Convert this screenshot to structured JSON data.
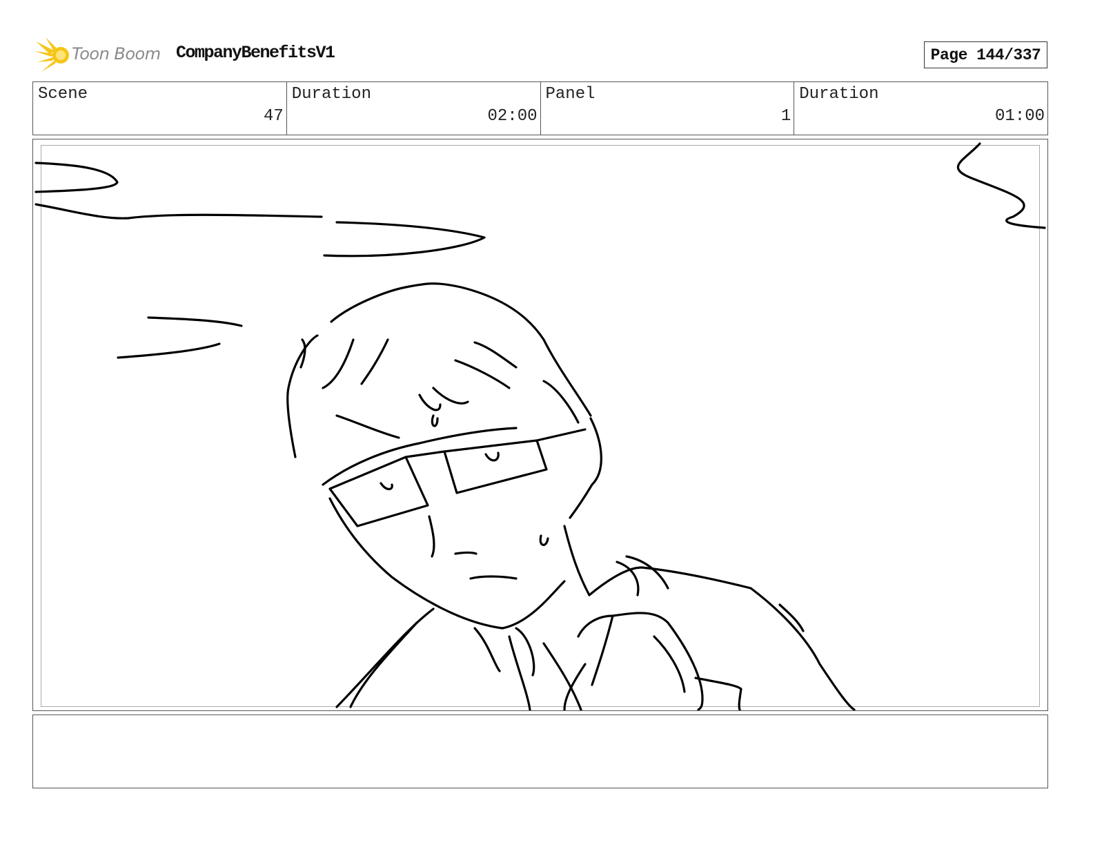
{
  "header": {
    "logo_text": "Toon Boom",
    "project_title": "CompanyBenefitsV1",
    "page_label": "Page 144/337"
  },
  "info": {
    "scene_label": "Scene",
    "scene_value": "47",
    "scene_duration_label": "Duration",
    "scene_duration_value": "02:00",
    "panel_label": "Panel",
    "panel_value": "1",
    "panel_duration_label": "Duration",
    "panel_duration_value": "01:00"
  },
  "colors": {
    "logo_yellow": "#f5c518",
    "logo_text_grey": "#8a8a8a",
    "border": "#555555"
  },
  "icons": {
    "logo": "toon-boom-starburst-icon"
  }
}
